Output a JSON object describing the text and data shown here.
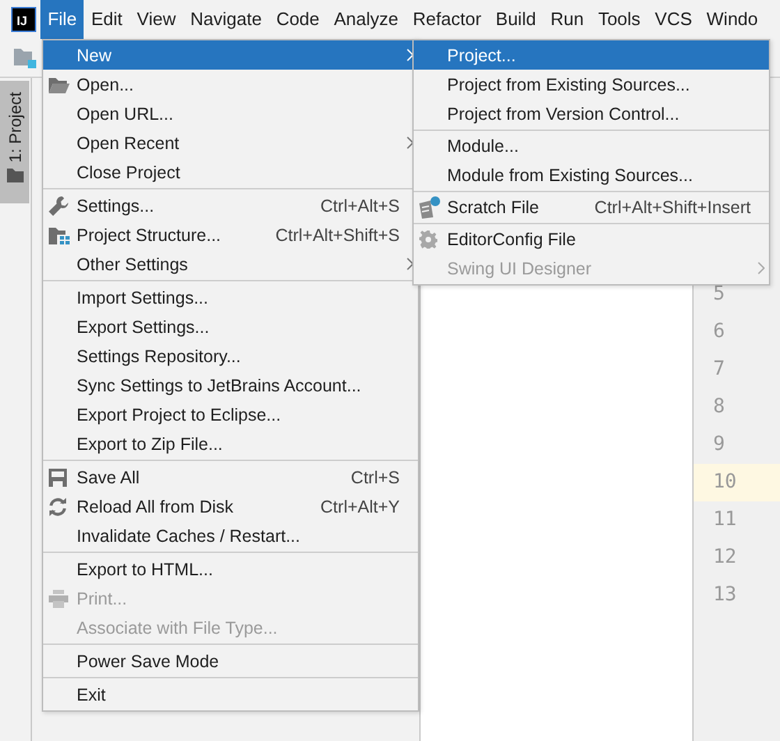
{
  "logo": "IJ",
  "menu_bar": [
    {
      "label": "File",
      "selected": true
    },
    {
      "label": "Edit",
      "selected": false
    },
    {
      "label": "View",
      "selected": false
    },
    {
      "label": "Navigate",
      "selected": false
    },
    {
      "label": "Code",
      "selected": false
    },
    {
      "label": "Analyze",
      "selected": false
    },
    {
      "label": "Refactor",
      "selected": false
    },
    {
      "label": "Build",
      "selected": false
    },
    {
      "label": "Run",
      "selected": false
    },
    {
      "label": "Tools",
      "selected": false
    },
    {
      "label": "VCS",
      "selected": false
    },
    {
      "label": "Windo",
      "selected": false
    }
  ],
  "tool_window_tab": {
    "label": "1: Project"
  },
  "file_menu": [
    [
      {
        "label": "New",
        "selected": true,
        "disabled": false,
        "submenu": true
      },
      {
        "label": "Open...",
        "selected": false,
        "disabled": false,
        "submenu": false
      },
      {
        "label": "Open URL...",
        "selected": false,
        "disabled": false,
        "submenu": false
      },
      {
        "label": "Open Recent",
        "selected": false,
        "disabled": false,
        "submenu": true
      },
      {
        "label": "Close Project",
        "selected": false,
        "disabled": false,
        "submenu": false
      }
    ],
    [
      {
        "label": "Settings...",
        "shortcut": "Ctrl+Alt+S",
        "selected": false,
        "disabled": false,
        "submenu": false
      },
      {
        "label": "Project Structure...",
        "shortcut": "Ctrl+Alt+Shift+S",
        "selected": false,
        "disabled": false,
        "submenu": false
      },
      {
        "label": "Other Settings",
        "selected": false,
        "disabled": false,
        "submenu": true
      }
    ],
    [
      {
        "label": "Import Settings...",
        "selected": false,
        "disabled": false,
        "submenu": false
      },
      {
        "label": "Export Settings...",
        "selected": false,
        "disabled": false,
        "submenu": false
      },
      {
        "label": "Settings Repository...",
        "selected": false,
        "disabled": false,
        "submenu": false
      },
      {
        "label": "Sync Settings to JetBrains Account...",
        "selected": false,
        "disabled": false,
        "submenu": false
      },
      {
        "label": "Export Project to Eclipse...",
        "selected": false,
        "disabled": false,
        "submenu": false
      },
      {
        "label": "Export to Zip File...",
        "selected": false,
        "disabled": false,
        "submenu": false
      }
    ],
    [
      {
        "label": "Save All",
        "shortcut": "Ctrl+S",
        "selected": false,
        "disabled": false,
        "submenu": false
      },
      {
        "label": "Reload All from Disk",
        "shortcut": "Ctrl+Alt+Y",
        "selected": false,
        "disabled": false,
        "submenu": false
      },
      {
        "label": "Invalidate Caches / Restart...",
        "selected": false,
        "disabled": false,
        "submenu": false
      }
    ],
    [
      {
        "label": "Export to HTML...",
        "selected": false,
        "disabled": false,
        "submenu": false
      },
      {
        "label": "Print...",
        "selected": false,
        "disabled": true,
        "submenu": false
      },
      {
        "label": "Associate with File Type...",
        "selected": false,
        "disabled": true,
        "submenu": false
      }
    ],
    [
      {
        "label": "Power Save Mode",
        "selected": false,
        "disabled": false,
        "submenu": false
      }
    ],
    [
      {
        "label": "Exit",
        "selected": false,
        "disabled": false,
        "submenu": false
      }
    ]
  ],
  "new_submenu": [
    [
      {
        "label": "Project...",
        "selected": true,
        "disabled": false,
        "submenu": false
      },
      {
        "label": "Project from Existing Sources...",
        "selected": false,
        "disabled": false,
        "submenu": false
      },
      {
        "label": "Project from Version Control...",
        "selected": false,
        "disabled": false,
        "submenu": false
      }
    ],
    [
      {
        "label": "Module...",
        "selected": false,
        "disabled": false,
        "submenu": false
      },
      {
        "label": "Module from Existing Sources...",
        "selected": false,
        "disabled": false,
        "submenu": false
      }
    ],
    [
      {
        "label": "Scratch File",
        "shortcut": "Ctrl+Alt+Shift+Insert",
        "selected": false,
        "disabled": false,
        "submenu": false
      }
    ],
    [
      {
        "label": "EditorConfig File",
        "selected": false,
        "disabled": false,
        "submenu": false
      },
      {
        "label": "Swing UI Designer",
        "selected": false,
        "disabled": true,
        "submenu": true
      }
    ]
  ],
  "gutter": [
    {
      "number": "5",
      "current": false
    },
    {
      "number": "6",
      "current": false
    },
    {
      "number": "7",
      "current": false
    },
    {
      "number": "8",
      "current": false
    },
    {
      "number": "9",
      "current": false
    },
    {
      "number": "10",
      "current": true
    },
    {
      "number": "11",
      "current": false
    },
    {
      "number": "12",
      "current": false
    },
    {
      "number": "13",
      "current": false
    }
  ]
}
